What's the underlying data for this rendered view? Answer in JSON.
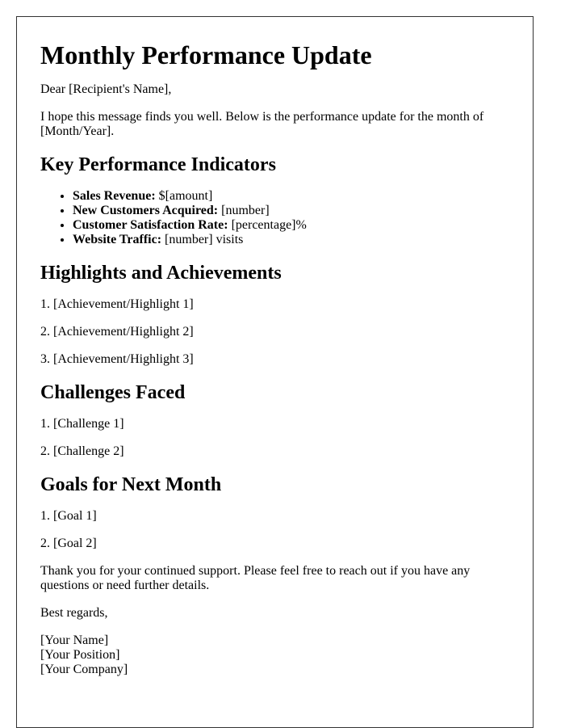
{
  "title": "Monthly Performance Update",
  "greeting": "Dear [Recipient's Name],",
  "intro": "I hope this message finds you well. Below is the performance update for the month of [Month/Year].",
  "kpi": {
    "heading": "Key Performance Indicators",
    "items": [
      {
        "label": "Sales Revenue:",
        "value": "$[amount]"
      },
      {
        "label": "New Customers Acquired:",
        "value": "[number]"
      },
      {
        "label": "Customer Satisfaction Rate:",
        "value": "[percentage]%"
      },
      {
        "label": "Website Traffic:",
        "value": "[number] visits"
      }
    ]
  },
  "highlights": {
    "heading": "Highlights and Achievements",
    "items": [
      "1. [Achievement/Highlight 1]",
      "2. [Achievement/Highlight 2]",
      "3. [Achievement/Highlight 3]"
    ]
  },
  "challenges": {
    "heading": "Challenges Faced",
    "items": [
      "1. [Challenge 1]",
      "2. [Challenge 2]"
    ]
  },
  "goals": {
    "heading": "Goals for Next Month",
    "items": [
      "1. [Goal 1]",
      "2. [Goal 2]"
    ]
  },
  "closing": "Thank you for your continued support. Please feel free to reach out if you have any questions or need further details.",
  "signoff": "Best regards,",
  "signature": {
    "name": "[Your Name]",
    "position": "[Your Position]",
    "company": "[Your Company]"
  }
}
